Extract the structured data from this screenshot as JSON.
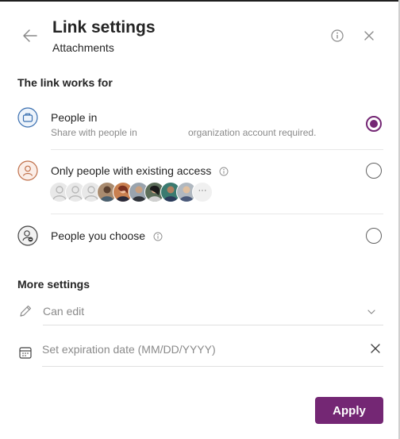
{
  "header": {
    "title": "Link settings",
    "subtitle": "Attachments",
    "back_icon": "arrow-left-icon",
    "info_icon": "info-icon",
    "close_icon": "close-icon"
  },
  "link_section": {
    "title": "The link works for",
    "options": [
      {
        "label": "People in",
        "description_left": "Share with people in",
        "description_right": "organization account required.",
        "icon": "briefcase-icon",
        "selected": true
      },
      {
        "label": "Only people with existing access",
        "icon": "person-icon",
        "selected": false,
        "avatar_more": "···"
      },
      {
        "label": "People you choose",
        "icon": "person-add-icon",
        "selected": false
      }
    ]
  },
  "more_settings": {
    "title": "More settings",
    "permission_value": "Can edit",
    "expiration_placeholder": "Set expiration date (MM/DD/YYYY)"
  },
  "footer": {
    "apply_label": "Apply"
  },
  "colors": {
    "accent": "#742774",
    "text": "#242424",
    "muted": "#8a8a8a"
  }
}
